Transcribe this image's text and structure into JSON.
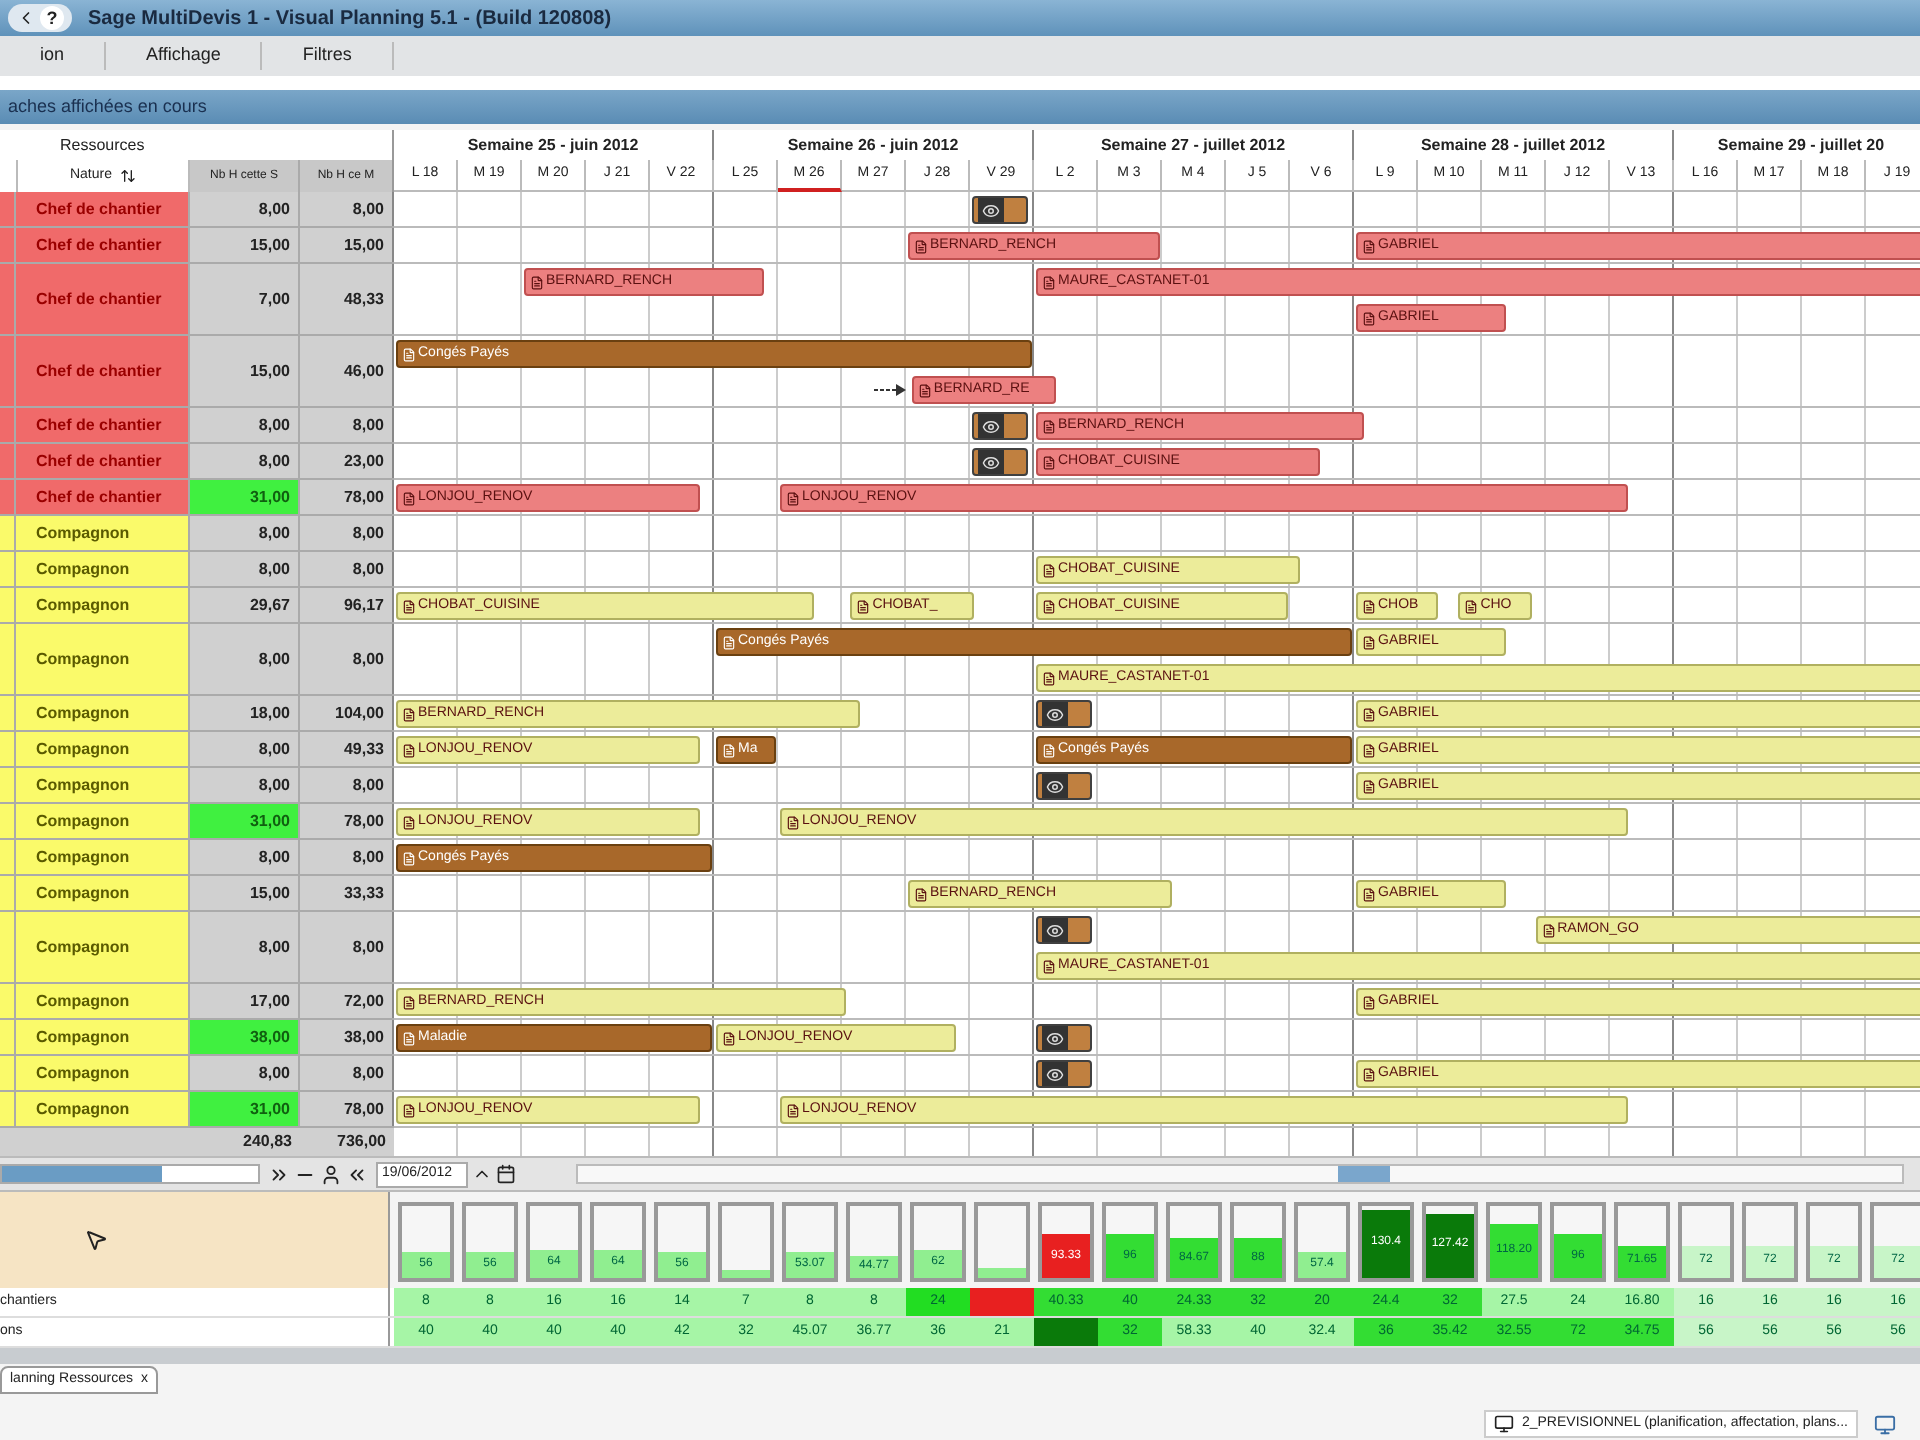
{
  "window": {
    "title": "Sage MultiDevis 1 - Visual Planning 5.1 - (Build 120808)",
    "help": "?"
  },
  "menu": [
    "ion",
    "Affichage",
    "Filtres"
  ],
  "panel_title": "aches affichées en cours",
  "resources": {
    "heading": "Ressources",
    "columns": [
      "Nature",
      "Nb H cette S",
      "Nb H ce M"
    ],
    "rows": [
      {
        "kind": "chef",
        "nature": "Chef de chantier",
        "week_hours": "8,00",
        "highlighted": false,
        "month_hours": "8,00",
        "lanes": [
          [
            {
              "kind": "marker"
            }
          ]
        ]
      },
      {
        "kind": "chef",
        "nature": "Chef de chantier",
        "week_hours": "15,00",
        "highlighted": false,
        "month_hours": "15,00",
        "lanes": [
          [
            {
              "kind": "task",
              "label": "BERNARD_RENCH"
            },
            {
              "kind": "task",
              "label": "GABRIEL"
            }
          ]
        ]
      },
      {
        "kind": "chef",
        "nature": "Chef de chantier",
        "week_hours": "7,00",
        "highlighted": false,
        "month_hours": "48,33",
        "lanes": [
          [
            {
              "kind": "task",
              "label": "BERNARD_RENCH"
            },
            {
              "kind": "task",
              "label": "MAURE_CASTANET-01"
            }
          ],
          [
            {
              "kind": "task",
              "label": "GABRIEL"
            }
          ]
        ]
      },
      {
        "kind": "chef",
        "nature": "Chef de chantier",
        "week_hours": "15,00",
        "highlighted": false,
        "month_hours": "46,00",
        "lanes": [
          [
            {
              "kind": "leave",
              "label": "Congés Payés"
            }
          ],
          [
            {
              "kind": "task",
              "label": "BERNARD_RE",
              "linked": true
            }
          ]
        ]
      },
      {
        "kind": "chef",
        "nature": "Chef de chantier",
        "week_hours": "8,00",
        "highlighted": false,
        "month_hours": "8,00",
        "lanes": [
          [
            {
              "kind": "marker"
            },
            {
              "kind": "task",
              "label": "BERNARD_RENCH"
            }
          ]
        ]
      },
      {
        "kind": "chef",
        "nature": "Chef de chantier",
        "week_hours": "8,00",
        "highlighted": false,
        "month_hours": "23,00",
        "lanes": [
          [
            {
              "kind": "marker"
            },
            {
              "kind": "task",
              "label": "CHOBAT_CUISINE"
            }
          ]
        ]
      },
      {
        "kind": "chef",
        "nature": "Chef de chantier",
        "week_hours": "31,00",
        "highlighted": true,
        "month_hours": "78,00",
        "lanes": [
          [
            {
              "kind": "task",
              "label": "LONJOU_RENOV"
            },
            {
              "kind": "task",
              "label": "LONJOU_RENOV"
            }
          ]
        ]
      },
      {
        "kind": "compagnon",
        "nature": "Compagnon",
        "week_hours": "8,00",
        "highlighted": false,
        "month_hours": "8,00"
      },
      {
        "kind": "compagnon",
        "nature": "Compagnon",
        "week_hours": "8,00",
        "highlighted": false,
        "month_hours": "8,00",
        "lanes": [
          [
            {
              "kind": "task",
              "label": "CHOBAT_CUISINE"
            }
          ]
        ]
      },
      {
        "kind": "compagnon",
        "nature": "Compagnon",
        "week_hours": "29,67",
        "highlighted": false,
        "month_hours": "96,17",
        "lanes": [
          [
            {
              "kind": "task",
              "label": "CHOBAT_CUISINE"
            },
            {
              "kind": "task",
              "label": "CHOBAT_"
            },
            {
              "kind": "task",
              "label": "CHOBAT_CUISINE"
            },
            {
              "kind": "task",
              "label": "CHOB"
            },
            {
              "kind": "task",
              "label": "CHO"
            }
          ]
        ]
      },
      {
        "kind": "compagnon",
        "nature": "Compagnon",
        "week_hours": "8,00",
        "highlighted": false,
        "month_hours": "8,00",
        "lanes": [
          [
            {
              "kind": "leave",
              "label": "Congés Payés"
            },
            {
              "kind": "task",
              "label": "GABRIEL"
            }
          ],
          [
            {
              "kind": "task",
              "label": "MAURE_CASTANET-01"
            }
          ]
        ]
      },
      {
        "kind": "compagnon",
        "nature": "Compagnon",
        "week_hours": "18,00",
        "highlighted": false,
        "month_hours": "104,00",
        "lanes": [
          [
            {
              "kind": "task",
              "label": "BERNARD_RENCH"
            },
            {
              "kind": "marker"
            },
            {
              "kind": "task",
              "label": "GABRIEL"
            }
          ]
        ]
      },
      {
        "kind": "compagnon",
        "nature": "Compagnon",
        "week_hours": "8,00",
        "highlighted": false,
        "month_hours": "49,33",
        "lanes": [
          [
            {
              "kind": "task",
              "label": "LONJOU_RENOV"
            },
            {
              "kind": "leave",
              "label": "Ma"
            },
            {
              "kind": "leave",
              "label": "Congés Payés"
            },
            {
              "kind": "task",
              "label": "GABRIEL"
            }
          ]
        ]
      },
      {
        "kind": "compagnon",
        "nature": "Compagnon",
        "week_hours": "8,00",
        "highlighted": false,
        "month_hours": "8,00",
        "lanes": [
          [
            {
              "kind": "marker"
            },
            {
              "kind": "task",
              "label": "GABRIEL"
            }
          ]
        ]
      },
      {
        "kind": "compagnon",
        "nature": "Compagnon",
        "week_hours": "31,00",
        "highlighted": true,
        "month_hours": "78,00",
        "lanes": [
          [
            {
              "kind": "task",
              "label": "LONJOU_RENOV"
            },
            {
              "kind": "task",
              "label": "LONJOU_RENOV"
            }
          ]
        ]
      },
      {
        "kind": "compagnon",
        "nature": "Compagnon",
        "week_hours": "8,00",
        "highlighted": false,
        "month_hours": "8,00",
        "lanes": [
          [
            {
              "kind": "leave",
              "label": "Congés Payés"
            }
          ]
        ]
      },
      {
        "kind": "compagnon",
        "nature": "Compagnon",
        "week_hours": "15,00",
        "highlighted": false,
        "month_hours": "33,33",
        "lanes": [
          [
            {
              "kind": "task",
              "label": "BERNARD_RENCH"
            },
            {
              "kind": "task",
              "label": "GABRIEL"
            }
          ]
        ]
      },
      {
        "kind": "compagnon",
        "nature": "Compagnon",
        "week_hours": "8,00",
        "highlighted": false,
        "month_hours": "8,00",
        "lanes": [
          [
            {
              "kind": "marker"
            },
            {
              "kind": "task",
              "label": "RAMON_GO"
            }
          ],
          [
            {
              "kind": "task",
              "label": "MAURE_CASTANET-01"
            }
          ]
        ]
      },
      {
        "kind": "compagnon",
        "nature": "Compagnon",
        "week_hours": "17,00",
        "highlighted": false,
        "month_hours": "72,00",
        "lanes": [
          [
            {
              "kind": "task",
              "label": "BERNARD_RENCH"
            },
            {
              "kind": "task",
              "label": "GABRIEL"
            }
          ]
        ]
      },
      {
        "kind": "compagnon",
        "nature": "Compagnon",
        "week_hours": "38,00",
        "highlighted": true,
        "month_hours": "38,00",
        "lanes": [
          [
            {
              "kind": "leave",
              "label": "Maladie"
            },
            {
              "kind": "task",
              "label": "LONJOU_RENOV"
            },
            {
              "kind": "marker"
            }
          ]
        ]
      },
      {
        "kind": "compagnon",
        "nature": "Compagnon",
        "week_hours": "8,00",
        "highlighted": false,
        "month_hours": "8,00",
        "lanes": [
          [
            {
              "kind": "marker"
            },
            {
              "kind": "task",
              "label": "GABRIEL"
            }
          ]
        ]
      },
      {
        "kind": "compagnon",
        "nature": "Compagnon",
        "week_hours": "31,00",
        "highlighted": true,
        "month_hours": "78,00",
        "lanes": [
          [
            {
              "kind": "task",
              "label": "LONJOU_RENOV"
            },
            {
              "kind": "task",
              "label": "LONJOU_RENOV"
            }
          ]
        ]
      }
    ],
    "totals": [
      "240,83",
      "736,00"
    ]
  },
  "weeks": [
    {
      "label": "Semaine 25 - juin 2012",
      "days": [
        {
          "label": "L 18",
          "selected": false
        },
        {
          "label": "M 19",
          "selected": false
        },
        {
          "label": "M 20",
          "selected": false
        },
        {
          "label": "J 21",
          "selected": false
        },
        {
          "label": "V 22",
          "selected": false
        }
      ]
    },
    {
      "label": "Semaine 26 - juin 2012",
      "days": [
        {
          "label": "L 25",
          "selected": false
        },
        {
          "label": "M 26",
          "selected": true
        },
        {
          "label": "M 27",
          "selected": false
        },
        {
          "label": "J 28",
          "selected": false
        },
        {
          "label": "V 29",
          "selected": false
        }
      ]
    },
    {
      "label": "Semaine 27 - juillet 2012",
      "days": [
        {
          "label": "L 2",
          "selected": false
        },
        {
          "label": "M 3",
          "selected": false
        },
        {
          "label": "M 4",
          "selected": false
        },
        {
          "label": "J 5",
          "selected": false
        },
        {
          "label": "V 6",
          "selected": false
        }
      ]
    },
    {
      "label": "Semaine 28 - juillet 2012",
      "days": [
        {
          "label": "L 9",
          "selected": false
        },
        {
          "label": "M 10",
          "selected": false
        },
        {
          "label": "M 11",
          "selected": false
        },
        {
          "label": "J 12",
          "selected": false
        },
        {
          "label": "V 13",
          "selected": false
        }
      ]
    },
    {
      "label": "Semaine 29 - juillet 20",
      "days": [
        {
          "label": "L 16",
          "selected": false
        },
        {
          "label": "M 17",
          "selected": false
        },
        {
          "label": "M 18",
          "selected": false
        },
        {
          "label": "J 19",
          "selected": false
        }
      ]
    }
  ],
  "toolbar": {
    "date": "19/06/2012"
  },
  "load": {
    "gauges": [
      {
        "label": "56",
        "level": 0.35,
        "color": "#90ee90"
      },
      {
        "label": "56",
        "level": 0.35,
        "color": "#90ee90"
      },
      {
        "label": "64",
        "level": 0.4,
        "color": "#90ee90"
      },
      {
        "label": "64",
        "level": 0.4,
        "color": "#90ee90"
      },
      {
        "label": "56",
        "level": 0.35,
        "color": "#90ee90"
      },
      {
        "level": 0.1,
        "color": "#90ee90"
      },
      {
        "label": "53.07",
        "level": 0.35,
        "color": "#90ee90"
      },
      {
        "label": "44.77",
        "level": 0.3,
        "color": "#90ee90"
      },
      {
        "label": "62",
        "level": 0.4,
        "color": "#90ee90"
      },
      {
        "level": 0.15,
        "color": "#90ee90"
      },
      {
        "label": "93.33",
        "level": 0.6,
        "color": "#e82020"
      },
      {
        "label": "96",
        "level": 0.6,
        "color": "#33dd33"
      },
      {
        "label": "84.67",
        "level": 0.55,
        "color": "#33dd33"
      },
      {
        "label": "88",
        "level": 0.55,
        "color": "#33dd33"
      },
      {
        "label": "57.4",
        "level": 0.35,
        "color": "#90ee90"
      },
      {
        "label": "130.4",
        "level": 0.95,
        "color": "#0a7a0a"
      },
      {
        "label": "127.42",
        "level": 0.9,
        "color": "#0a7a0a"
      },
      {
        "label": "118.20",
        "level": 0.75,
        "color": "#33dd33"
      },
      {
        "label": "96",
        "level": 0.6,
        "color": "#33dd33"
      },
      {
        "label": "71.65",
        "level": 0.45,
        "color": "#33dd33"
      },
      {
        "label": "72",
        "level": 0.45,
        "color": "#c8f5c8"
      },
      {
        "label": "72",
        "level": 0.45,
        "color": "#c8f5c8"
      },
      {
        "label": "72",
        "level": 0.45,
        "color": "#c8f5c8"
      },
      {
        "label": "72",
        "level": 0.45,
        "color": "#c8f5c8"
      }
    ],
    "rows": [
      {
        "label": "chantiers",
        "cells": [
          {
            "text": "8",
            "color": "#a6f5a6"
          },
          {
            "text": "8",
            "color": "#a6f5a6"
          },
          {
            "text": "16",
            "color": "#a6f5a6"
          },
          {
            "text": "16",
            "color": "#a6f5a6"
          },
          {
            "text": "14",
            "color": "#a6f5a6"
          },
          {
            "text": "7",
            "color": "#a6f5a6"
          },
          {
            "text": "8",
            "color": "#a6f5a6"
          },
          {
            "text": "8",
            "color": "#a6f5a6"
          },
          {
            "text": "24",
            "color": "#22dd22"
          },
          {
            "color": "#e82020"
          },
          {
            "text": "40.33",
            "color": "#33dd33"
          },
          {
            "text": "40",
            "color": "#33dd33"
          },
          {
            "text": "24.33",
            "color": "#33dd33"
          },
          {
            "text": "32",
            "color": "#33dd33"
          },
          {
            "text": "20",
            "color": "#33dd33"
          },
          {
            "text": "24.4",
            "color": "#33dd33"
          },
          {
            "text": "32",
            "color": "#33dd33"
          },
          {
            "text": "27.5",
            "color": "#a6f5a6"
          },
          {
            "text": "24",
            "color": "#a6f5a6"
          },
          {
            "text": "16.80",
            "color": "#a6f5a6"
          },
          {
            "text": "16",
            "color": "#c8f5c8"
          },
          {
            "text": "16",
            "color": "#c8f5c8"
          },
          {
            "text": "16",
            "color": "#c8f5c8"
          },
          {
            "text": "16",
            "color": "#c8f5c8"
          }
        ]
      },
      {
        "label": "ons",
        "cells": [
          {
            "text": "40",
            "color": "#a6f5a6"
          },
          {
            "text": "40",
            "color": "#a6f5a6"
          },
          {
            "text": "40",
            "color": "#a6f5a6"
          },
          {
            "text": "40",
            "color": "#a6f5a6"
          },
          {
            "text": "42",
            "color": "#a6f5a6"
          },
          {
            "text": "32",
            "color": "#a6f5a6"
          },
          {
            "text": "45.07",
            "color": "#a6f5a6"
          },
          {
            "text": "36.77",
            "color": "#a6f5a6"
          },
          {
            "text": "36",
            "color": "#a6f5a6"
          },
          {
            "text": "21",
            "color": "#a6f5a6"
          },
          {
            "color": "#0a7a0a"
          },
          {
            "text": "32",
            "color": "#33dd33"
          },
          {
            "text": "58.33",
            "color": "#a6f5a6"
          },
          {
            "text": "40",
            "color": "#a6f5a6"
          },
          {
            "text": "32.4",
            "color": "#a6f5a6"
          },
          {
            "text": "36",
            "color": "#33dd33"
          },
          {
            "text": "35.42",
            "color": "#33dd33"
          },
          {
            "text": "32.55",
            "color": "#33dd33"
          },
          {
            "text": "72",
            "color": "#33dd33"
          },
          {
            "text": "34.75",
            "color": "#33dd33"
          },
          {
            "text": "56",
            "color": "#c8f5c8"
          },
          {
            "text": "56",
            "color": "#c8f5c8"
          },
          {
            "text": "56",
            "color": "#c8f5c8"
          },
          {
            "text": "56",
            "color": "#c8f5c8"
          }
        ]
      }
    ]
  },
  "document_tab": {
    "label": "lanning Ressources",
    "close": "x"
  },
  "taskbar": {
    "item": "2_PREVISIONNEL (planification, affectation, plans..."
  }
}
